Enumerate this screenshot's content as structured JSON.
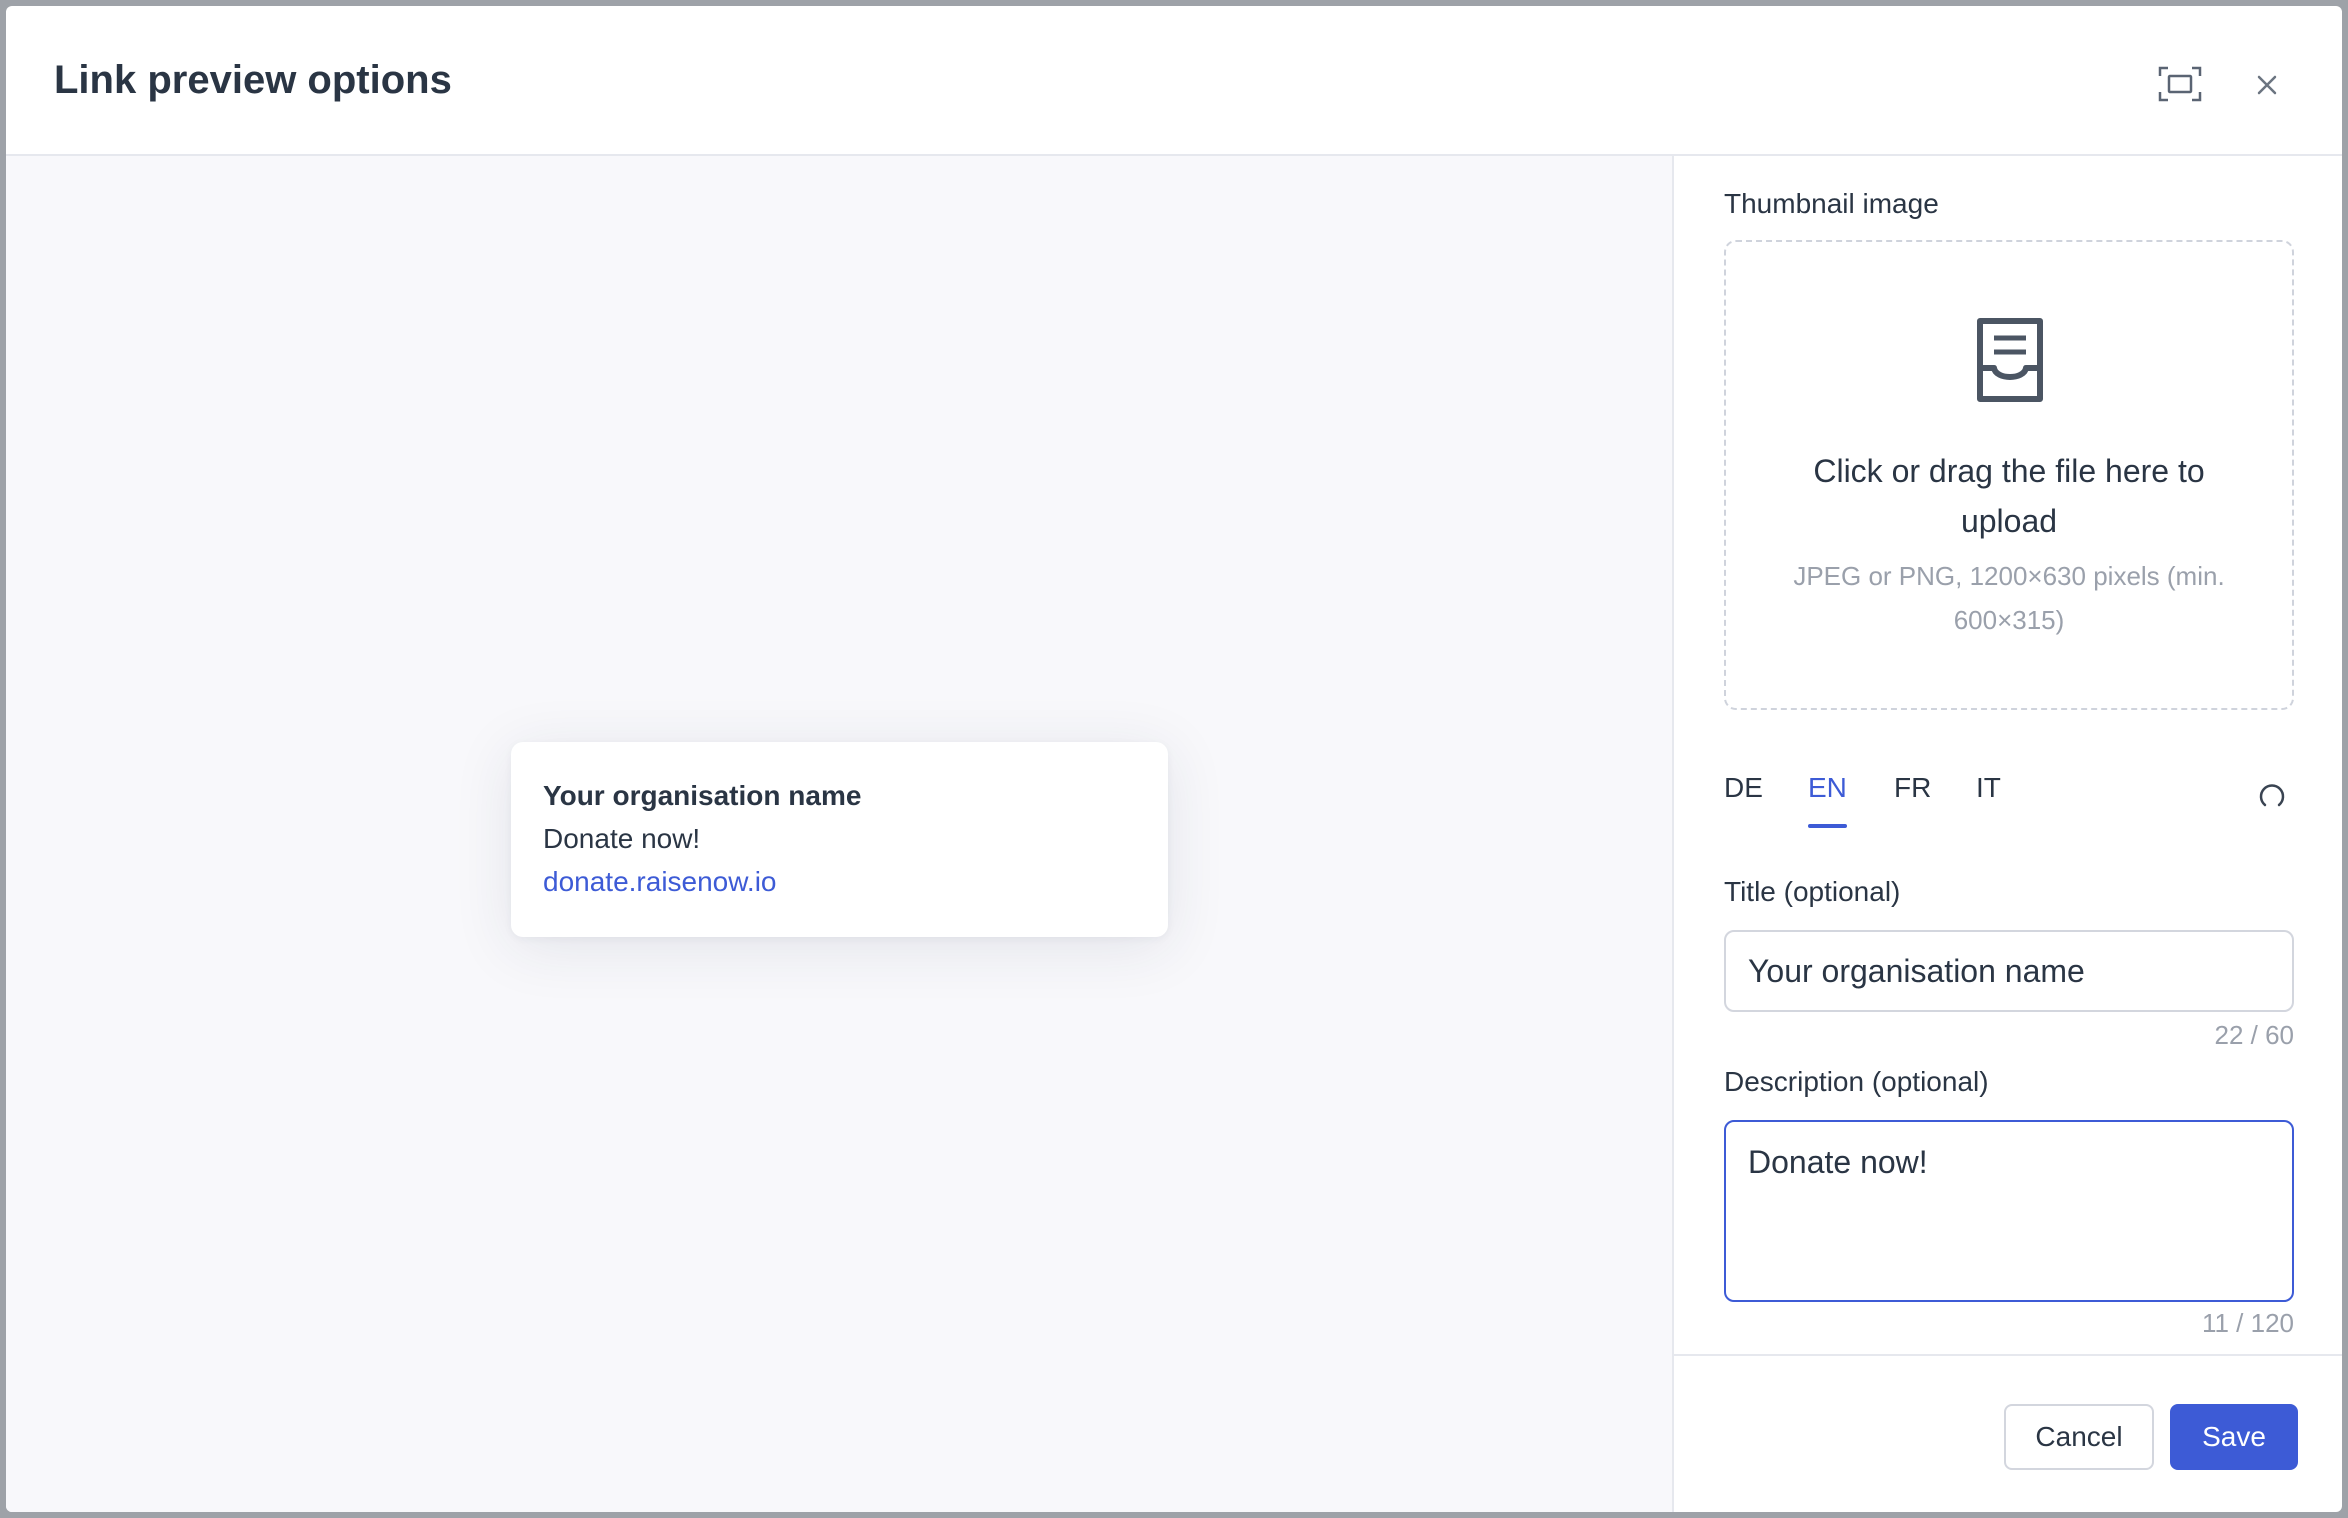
{
  "modal": {
    "title": "Link preview options",
    "icons": {
      "expand": "expand-icon",
      "close": "close-icon"
    }
  },
  "preview": {
    "title": "Your organisation name",
    "description": "Donate now!",
    "url": "donate.raisenow.io"
  },
  "thumbnail": {
    "label": "Thumbnail image",
    "icon": "upload-tray-icon",
    "upload_text": "Click or drag the file here to upload",
    "hint": "JPEG or PNG, 1200×630 pixels (min. 600×315)"
  },
  "languages": {
    "tabs": [
      "DE",
      "EN",
      "FR",
      "IT"
    ],
    "active": "EN",
    "reset_icon": "reset-icon"
  },
  "form": {
    "title_label": "Title (optional)",
    "title_value": "Your organisation name",
    "title_counter": "22 / 60",
    "description_label": "Description (optional)",
    "description_value": "Donate now!",
    "description_counter": "11 / 120"
  },
  "footer": {
    "cancel_label": "Cancel",
    "save_label": "Save"
  },
  "colors": {
    "accent": "#3d5bd6",
    "text": "#2a3544",
    "muted": "#9aa0ab",
    "preview_bg": "#f8f8fb"
  }
}
